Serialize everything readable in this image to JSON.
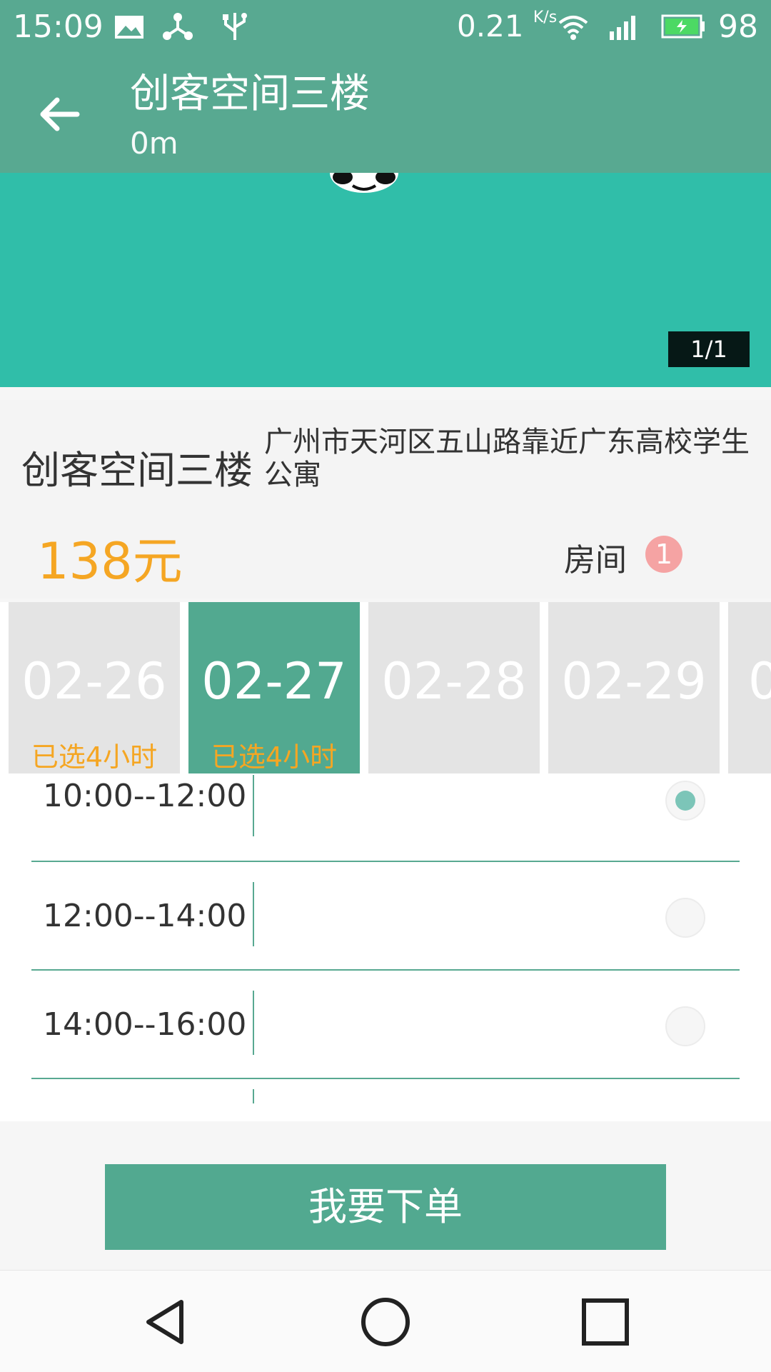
{
  "status_bar": {
    "time": "15:09",
    "net_speed": "0.21",
    "net_unit": "K/s",
    "battery": "98",
    "icons": [
      "image-icon",
      "share-icon",
      "usb-icon",
      "wifi-icon",
      "signal-4g-icon",
      "battery-icon"
    ]
  },
  "toolbar": {
    "title": "创客空间三楼",
    "subtitle": "0m",
    "back_icon": "arrow-left-icon"
  },
  "banner": {
    "page_indicator": "1/1",
    "color": "#30bea9"
  },
  "space": {
    "name": "创客空间三楼",
    "address": "广州市天河区五山路靠近广东高校学生公寓",
    "price": "138元",
    "room_label": "房间",
    "room_count": "1"
  },
  "dates": [
    {
      "date": "02-26",
      "status": "已选4小时",
      "selected": false
    },
    {
      "date": "02-27",
      "status": "已选4小时",
      "selected": true
    },
    {
      "date": "02-28",
      "status": "",
      "selected": false
    },
    {
      "date": "02-29",
      "status": "",
      "selected": false
    },
    {
      "date": "0",
      "status": "",
      "selected": false
    }
  ],
  "slots": [
    {
      "time": "10:00--12:00",
      "checked": true
    },
    {
      "time": "12:00--14:00",
      "checked": false
    },
    {
      "time": "14:00--16:00",
      "checked": false
    }
  ],
  "order_button": "我要下单",
  "nav": {
    "back": "nav-back-icon",
    "home": "nav-home-icon",
    "recents": "nav-recents-icon"
  },
  "colors": {
    "primary": "#58a991",
    "accent": "#f5a623",
    "badge": "#f5a3a3"
  }
}
